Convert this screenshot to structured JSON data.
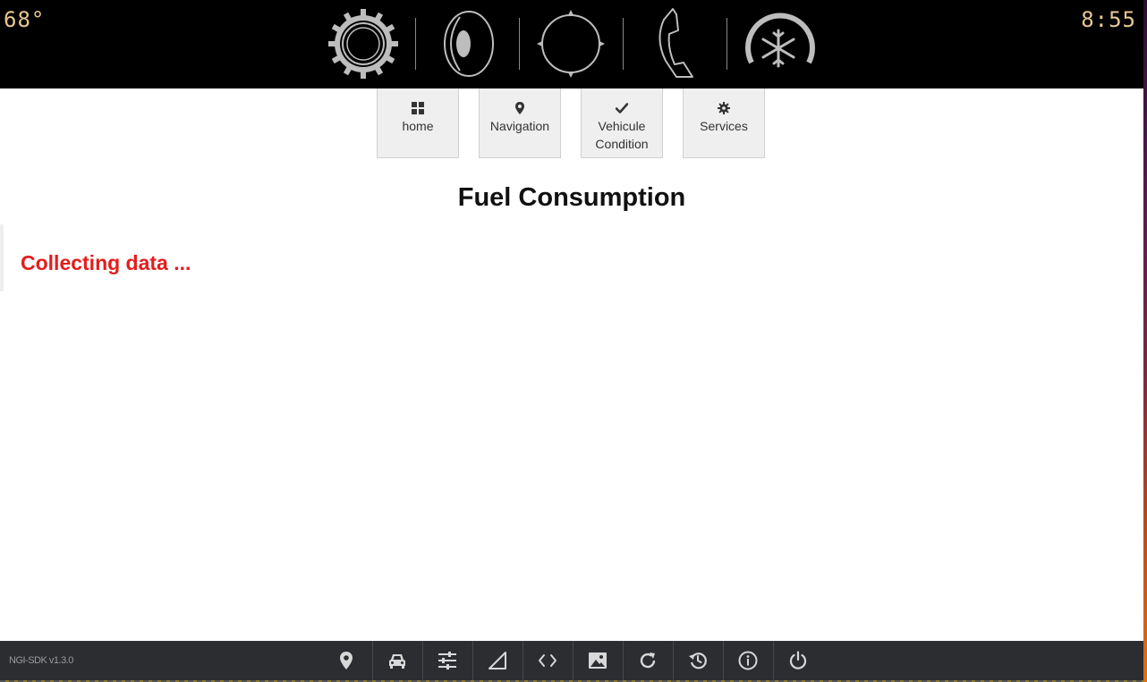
{
  "topbar": {
    "temperature": "68°",
    "clock": "8:55",
    "accent_color": "#e8c890",
    "icons": [
      "settings-gear-icon",
      "speaker-icon",
      "navigation-compass-icon",
      "phone-icon",
      "climate-snowflake-icon"
    ]
  },
  "nav": {
    "items": [
      {
        "label": "home",
        "icon": "grid-icon"
      },
      {
        "label": "Navigation",
        "icon": "map-pin-icon"
      },
      {
        "label": "Vehicule Condition",
        "icon": "check-icon"
      },
      {
        "label": "Services",
        "icon": "cog-icon"
      }
    ]
  },
  "main": {
    "title": "Fuel Consumption",
    "status": "Collecting data ...",
    "status_color": "#e51c1c"
  },
  "bottombar": {
    "version": "NGI-SDK v1.3.0",
    "buttons": [
      "location-icon",
      "car-icon",
      "sliders-icon",
      "signal-icon",
      "code-icon",
      "image-icon",
      "refresh-icon",
      "history-icon",
      "info-icon",
      "power-icon"
    ]
  }
}
